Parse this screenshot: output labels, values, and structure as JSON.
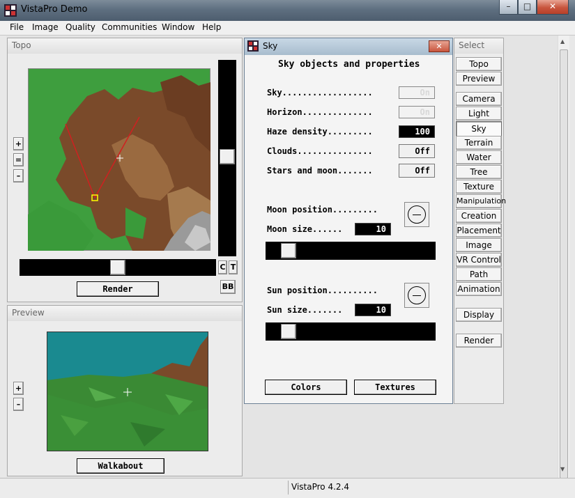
{
  "window": {
    "title": "VistaPro Demo",
    "minimize": "–",
    "maximize": "□",
    "close": "✕"
  },
  "menu": [
    "File",
    "Image",
    "Quality",
    "Communities",
    "Window",
    "Help"
  ],
  "topo": {
    "title": "Topo",
    "zoom_in": "+",
    "zoom_reset": "=",
    "zoom_out": "–",
    "render_label": "Render",
    "c_label": "C",
    "t_label": "T",
    "bb_label": "BB"
  },
  "preview": {
    "title": "Preview",
    "zoom_in": "+",
    "zoom_out": "–",
    "walkabout_label": "Walkabout"
  },
  "sky_dialog": {
    "title": "Sky",
    "close": "✕",
    "heading": "Sky objects and properties",
    "rows": [
      {
        "label": "Sky..................",
        "value": "On",
        "style": "disabled"
      },
      {
        "label": "Horizon..............",
        "value": "On",
        "style": "disabled"
      },
      {
        "label": "Haze density.........",
        "value": "100",
        "style": "black"
      },
      {
        "label": "Clouds...............",
        "value": "Off",
        "style": "normal"
      },
      {
        "label": "Stars and moon.......",
        "value": "Off",
        "style": "normal"
      }
    ],
    "moon_position_label": "Moon position.........",
    "moon_size_label": "Moon size......",
    "moon_size_value": "10",
    "sun_position_label": "Sun position..........",
    "sun_size_label": "Sun size.......",
    "sun_size_value": "10",
    "colors_label": "Colors",
    "textures_label": "Textures"
  },
  "select_panel": {
    "title": "Select",
    "buttons": [
      "Topo",
      "Preview",
      "Camera",
      "Light",
      "Sky",
      "Terrain",
      "Water",
      "Tree",
      "Texture",
      "Manipulation",
      "Creation",
      "Placement",
      "Image",
      "VR Control",
      "Path",
      "Animation",
      "Display",
      "Render"
    ],
    "active": "Sky"
  },
  "status": {
    "version": "VistaPro 4.2.4"
  }
}
